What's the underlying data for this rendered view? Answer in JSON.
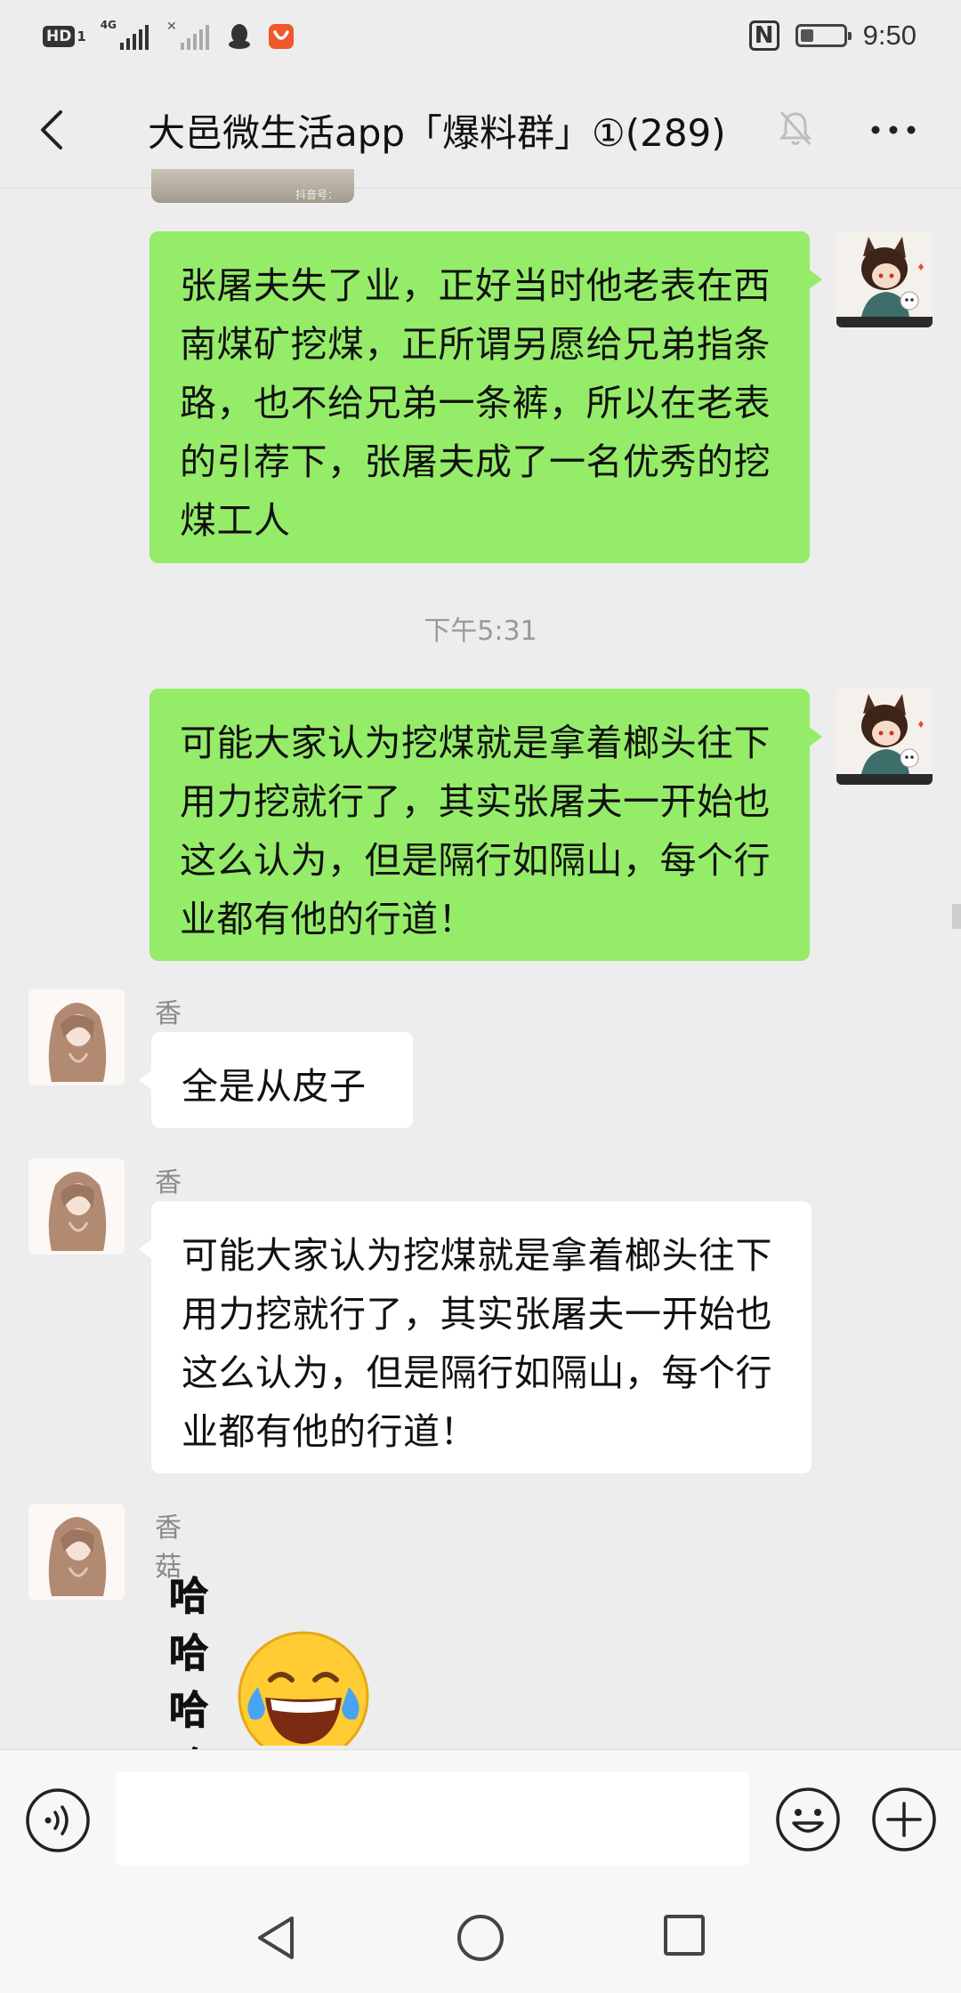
{
  "status_bar": {
    "hd_label": "HD",
    "hd_sub": "1",
    "network_label": "4G",
    "time": "9:50",
    "nfc_label": "N",
    "battery_level": 0.3
  },
  "header": {
    "title": "大邑微生活app「爆料群」①(289)",
    "icons": {
      "back": "back-arrow-icon",
      "mute": "bell-muted-icon",
      "more": "more-icon"
    }
  },
  "messages": [
    {
      "type": "text",
      "from": "me",
      "text": "张屠夫失了业，正好当时他老表在西南煤矿挖煤，正所谓另愿给兄弟指条路，也不给兄弟一条裤，所以在老表的引荐下，张屠夫成了一名优秀的挖煤工人"
    },
    {
      "type": "time",
      "text": "下午5:31"
    },
    {
      "type": "text",
      "from": "me",
      "text": "可能大家认为挖煤就是拿着榔头往下用力挖就行了，其实张屠夫一开始也这么认为，但是隔行如隔山，每个行业都有他的行道！"
    },
    {
      "type": "text",
      "from": "other",
      "sender": "香菇",
      "text": "全是从皮子"
    },
    {
      "type": "text",
      "from": "other",
      "sender": "香菇",
      "text": "可能大家认为挖煤就是拿着榔头往下用力挖就行了，其实张屠夫一开始也这么认为，但是隔行如隔山，每个行业都有他的行道！"
    },
    {
      "type": "sticker",
      "from": "other",
      "sender": "香菇",
      "text": "哈哈哈哈哈",
      "icon": "laughing-tears-emoji-icon"
    }
  ],
  "input_bar": {
    "value": "",
    "icons": {
      "voice": "voice-icon",
      "emoji": "emoji-icon",
      "more": "plus-icon"
    }
  },
  "nav_bar": {
    "icons": {
      "back": "nav-back-icon",
      "home": "nav-home-icon",
      "recent": "nav-recent-icon"
    }
  }
}
